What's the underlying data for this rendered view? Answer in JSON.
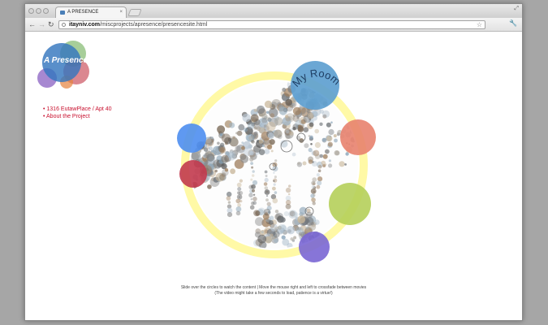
{
  "browser": {
    "tab_title": "A PRESENCE",
    "tab_close": "×",
    "url_domain": "itayniv.com",
    "url_path": "/miscprojects/apresence/presencesite.html",
    "back_glyph": "←",
    "forward_glyph": "→",
    "reload_glyph": "↻",
    "star_glyph": "☆",
    "wrench_glyph": "🔧",
    "resize_glyph": "⤢"
  },
  "logo": {
    "text": "A Presence"
  },
  "nav_links": [
    "• 1316 EutawPlace / Apt 40",
    "• About the Project"
  ],
  "visualization": {
    "room_bubble_label": "My Room",
    "ring_color": "#fff9a6"
  },
  "footer": {
    "line1": "Slide over the circles to watch the content | Move the mouse right and left to crossfade between movies",
    "line2": "(The video might take a few seconds to load, patience is a virtue!)"
  },
  "colors": {
    "link": "#c8102e",
    "bubble_blue": "#5e9fd0",
    "bubble_salmon": "#e8826e",
    "bubble_green": "#b5cf5a",
    "bubble_purple": "#7a66d4",
    "bubble_red": "#c23a4e",
    "bubble_bright_blue": "#4e8ef0"
  }
}
